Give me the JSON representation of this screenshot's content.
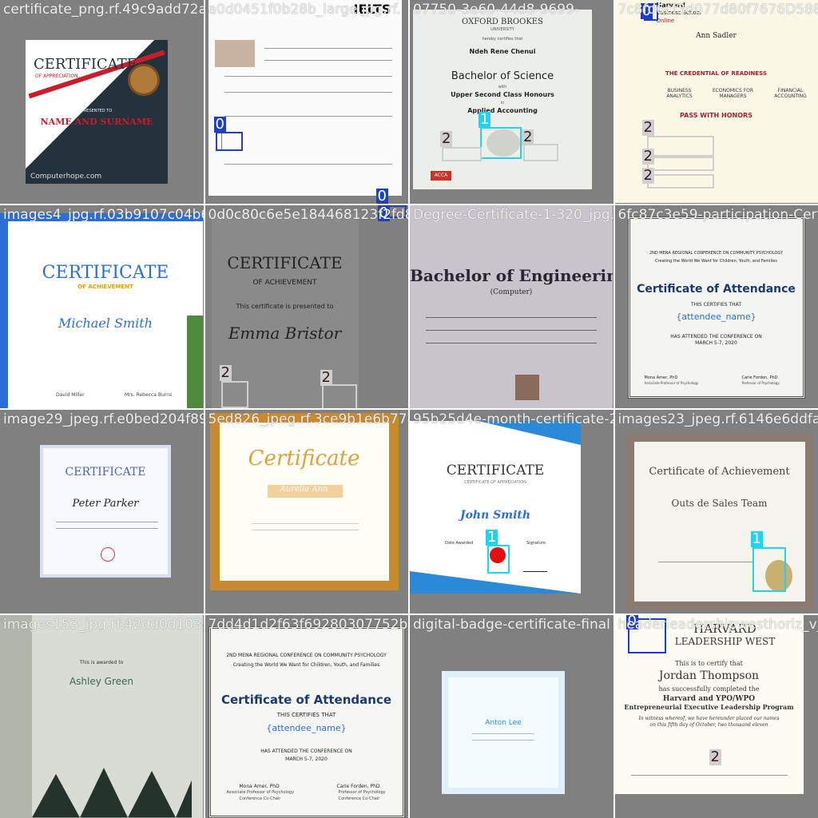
{
  "colors": {
    "class0": "#1e3fc0",
    "class1": "#22d3f0",
    "class2": "#cfcfcf",
    "tile_bg": "#808080"
  },
  "class_labels": {
    "c0": "0",
    "c1": "1",
    "c2": "2"
  },
  "tiles": [
    {
      "caption": "certificate_png.rf.49c9add72a0de0451f0b28",
      "doc": {
        "title": "CERTIFICATE",
        "subtitle": "OF APPRECIATION",
        "presented": "PRESENTED TO",
        "name": "NAME AND SURNAME",
        "footer": "Computerhope.com"
      }
    },
    {
      "caption": "a0d0451f0b28b_large.jpg.rf.",
      "doc": {
        "header": "IELTS"
      }
    },
    {
      "caption": "07750-3e60-44d8-9699-",
      "doc": {
        "univ": "OXFORD BROOKES",
        "univ2": "UNIVERSITY",
        "hereby": "hereby certifies that",
        "name": "Ndeh Rene Chenui",
        "degree": "Bachelor of Science",
        "with": "with",
        "honours": "Upper Second Class Honours",
        "in": "in",
        "subject": "Applied Accounting",
        "logo": "ACCA"
      }
    },
    {
      "caption": "7c8fd6cf3d077d80f7676D588",
      "doc": {
        "top1": "Harvard",
        "top2": "Business School",
        "top3": "Online",
        "name": "Ann Sadler",
        "credential": "THE CREDENTIAL OF READINESS",
        "c1": "BUSINESS ANALYTICS",
        "c2": "ECONOMICS FOR MANAGERS",
        "c3": "FINANCIAL ACCOUNTING",
        "honors": "PASS WITH HONORS"
      }
    },
    {
      "caption": "images4_jpg.rf.03b9107c04b60603e5e18443",
      "doc": {
        "title": "CERTIFICATE",
        "sub": "OF ACHIEVEMENT",
        "name": "Michael Smith",
        "s1": "David Miller",
        "s2": "Mrs. Rebecca Burns"
      }
    },
    {
      "caption": "0d0c80c6e5e184468123f2fd8e7fb",
      "doc": {
        "title": "CERTIFICATE",
        "sub": "OF ACHIEVEMENT",
        "presented": "This certificate is presented to",
        "name": "Emma Bristor"
      }
    },
    {
      "caption": "Degree-Certificate-1-320_jpg.rf.",
      "doc": {
        "line1": "Bachelor of Engineering",
        "line2": "(Computer)"
      }
    },
    {
      "caption": "6fc87c3e59-participation-Certi",
      "doc": {
        "conf": "2ND MENA REGIONAL CONFERENCE ON COMMUNITY PSYCHOLOGY",
        "theme": "Creating the World We Want for Children, Youth, and Families",
        "title": "Certificate of Attendance",
        "certifies": "THIS CERTIFIES THAT",
        "name": "{attendee_name}",
        "attended": "HAS ATTENDED THE CONFERENCE ON",
        "date": "MARCH 5-7, 2020",
        "s1": "Mona Amer, PhD",
        "s1r": "Associate Professor of Psychology",
        "s2": "Carie Forden, PhD",
        "s2r": "Professor of Psychology"
      }
    },
    {
      "caption": "image29_jpeg.rf.e0bed204f89",
      "doc": {
        "title": "CERTIFICATE",
        "name": "Peter Parker"
      }
    },
    {
      "caption": "5ed826_jpeg.rf.3ce9b1e6b77a0d",
      "doc": {
        "title": "Certificate",
        "name": "Aurelia Ann"
      }
    },
    {
      "caption": "95b25d4e-month-certificate-23_jpeg.",
      "doc": {
        "title": "CERTIFICATE",
        "sub": "CERTIFICATE OF APPRECIATION",
        "name": "John Smith",
        "date": "Date Awarded",
        "sign": "Signature"
      }
    },
    {
      "caption": "images23_jpeg.rf.6146e6ddfa",
      "doc": {
        "title": "Certificate of Achievement",
        "team": "Outs de Sales Team"
      }
    },
    {
      "caption": "images153_jpg.rf.42dd0d103",
      "doc": {
        "sub": "This is awarded to",
        "name": "Ashley Green"
      }
    },
    {
      "caption": "7dd4d1d2f63f69280307752bd",
      "doc": {
        "conf": "2ND MENA REGIONAL CONFERENCE ON COMMUNITY PSYCHOLOGY",
        "theme": "Creating the World We Want for Children, Youth, and Families",
        "title": "Certificate of Attendance",
        "certifies": "THIS CERTIFIES THAT",
        "name": "{attendee_name}",
        "attended": "HAS ATTENDED THE CONFERENCE ON",
        "date": "MARCH 5-7, 2020",
        "s1": "Mona Amer, PhD",
        "s1r": "Associate Professor of Psychology",
        "s1c": "Conference Co-Chair",
        "s2": "Carie Forden, PhD",
        "s2r": "Professor of Psychology",
        "s2c": "Conference Co-Chair"
      }
    },
    {
      "caption": "digital-badge-certificate-final",
      "doc": {
        "name": "Anton Lee"
      }
    },
    {
      "caption": "headerleadershipwesthoriz_v_3",
      "doc": {
        "h1": "HARVARD",
        "h2": "LEADERSHIP WEST",
        "l1": "This is to certify that",
        "name": "Jordan Thompson",
        "l2": "has successfully completed the",
        "l3": "Harvard and YPO/WPO",
        "l4": "Entrepreneurial Executive Leadership Program",
        "l5": "In witness whereof, we have hereunder placed our names",
        "l6": "on this fifth day of October, two thousand eleven"
      }
    }
  ]
}
